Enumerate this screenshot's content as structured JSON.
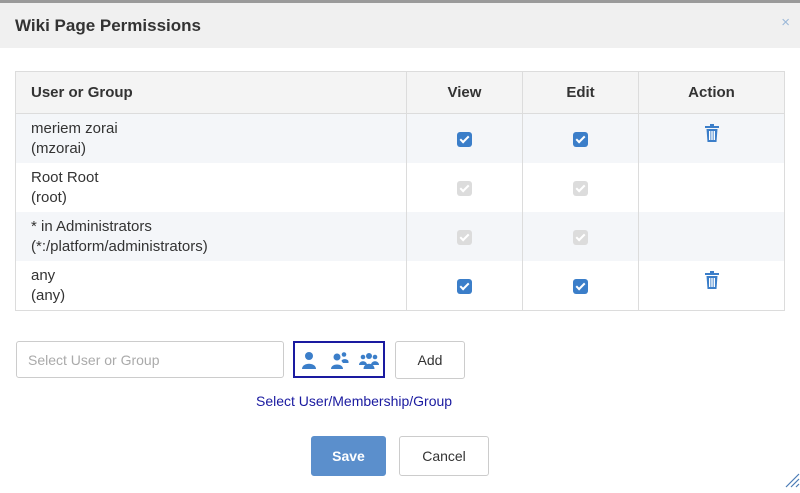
{
  "dialog": {
    "title": "Wiki Page Permissions",
    "close_label": "×"
  },
  "table": {
    "headers": {
      "user": "User or Group",
      "view": "View",
      "edit": "Edit",
      "action": "Action"
    },
    "rows": [
      {
        "name": "meriem zorai",
        "id": "(mzorai)",
        "view": true,
        "edit": true,
        "view_disabled": false,
        "edit_disabled": false,
        "deletable": true
      },
      {
        "name": "Root Root",
        "id": "(root)",
        "view": true,
        "edit": true,
        "view_disabled": true,
        "edit_disabled": true,
        "deletable": false
      },
      {
        "name": "* in Administrators",
        "id": "(*:/platform/administrators)",
        "view": true,
        "edit": true,
        "view_disabled": true,
        "edit_disabled": true,
        "deletable": false
      },
      {
        "name": "any",
        "id": "(any)",
        "view": true,
        "edit": true,
        "view_disabled": false,
        "edit_disabled": false,
        "deletable": true
      }
    ]
  },
  "add_form": {
    "placeholder": "Select User or Group",
    "add_label": "Add",
    "link_label": "Select User/Membership/Group",
    "type_icons": [
      "user-icon",
      "membership-icon",
      "group-icon"
    ]
  },
  "footer": {
    "save_label": "Save",
    "cancel_label": "Cancel"
  },
  "colors": {
    "accent": "#3b7ec9",
    "save": "#5b8fcc",
    "link": "#1a1aa0"
  }
}
